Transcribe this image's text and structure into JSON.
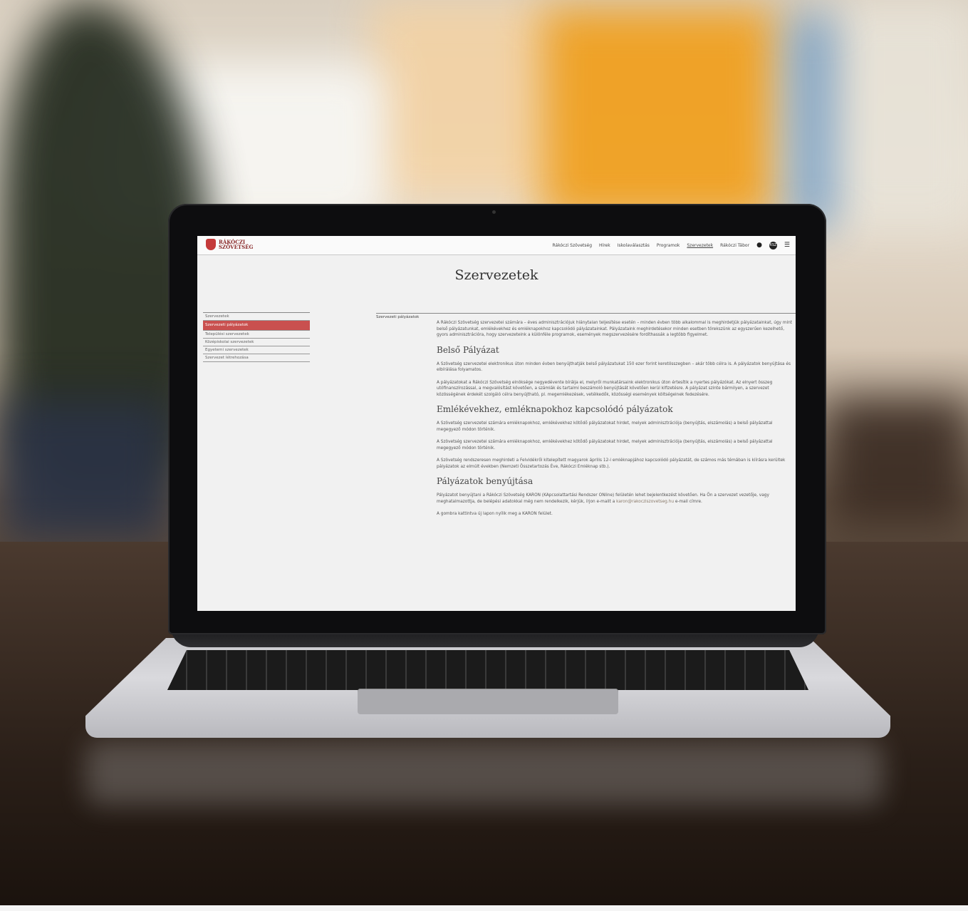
{
  "nav": {
    "logo_line1": "RÁKÓCZI",
    "logo_line2": "SZÖVETSÉG",
    "links": [
      "Rákóczi Szövetség",
      "Hírek",
      "Iskolaválasztás",
      "Programok",
      "Szervezetek",
      "Rákóczi Tábor"
    ],
    "active_link": "Szervezetek",
    "icons": [
      "search-icon",
      "user-icon",
      "menu-icon"
    ],
    "badge": "RSZ"
  },
  "page": {
    "title": "Szervezetek"
  },
  "sidebar": {
    "items": [
      "Szervezetek",
      "Szervezeti pályázatok",
      "Települési szervezetek",
      "Középiskolai szervezetek",
      "Egyetemi szervezetek",
      "Szervezet létrehozása"
    ],
    "active_index": 1
  },
  "content": {
    "section_label": "Szervezeti pályázatok",
    "intro": "A Rákóczi Szövetség szervezetei számára – éves adminisztrációjuk hiánytalan teljesítése esetén – minden évben több alkalommal is meghirdetjük pályázatainkat, úgy mint belső pályázatunkat, emlékévekhez és emléknapokhoz kapcsolódó pályázatainkat. Pályázataink meghirdetésekor minden esetben törekszünk az egyszerűen kezelhető, gyors adminisztrációra, hogy szervezeteink a különféle programok, események megszervezésére fordíthassák a legtöbb figyelmet.",
    "h_belso": "Belső Pályázat",
    "belso_p1": "A Szövetség szervezetei elektronikus úton minden évben benyújthatják belső pályázatukat 150 ezer forint keretösszegben – akár több célra is. A pályázatok benyújtása és elbírálása folyamatos.",
    "belso_p2": "A pályázatokat a Rákóczi Szövetség elnöksége negyedévente bírálja el, melyről munkatársaink elektronikus úton értesítik a nyertes pályázókat. Az elnyert összeg utófinanszírozással, a megvalósítást követően, a számlák és tartalmi beszámoló benyújtását követően kerül kifizetésre. A pályázat szinte bármilyen, a szervezet közösségének érdekét szolgáló célra benyújtható, pl. megemlékezések, vetélkedők, közösségi események költségeinek fedezésére.",
    "h_emlek": "Emlékévekhez, emléknapokhoz kapcsolódó pályázatok",
    "emlek_p1": "A Szövetség szervezetei számára emléknapokhoz, emlékévekhez kötődő pályázatokat hirdet, melyek adminisztrációja (benyújtás, elszámolás) a belső pályázattal megegyező módon történik.",
    "emlek_p2": "A Szövetség szervezetei számára emléknapokhoz, emlékévekhez kötődő pályázatokat hirdet, melyek adminisztrációja (benyújtás, elszámolás) a belső pályázattal megegyező módon történik.",
    "emlek_p3": "A Szövetség rendszeresen meghirdeti a Felvidékről kitelepített magyarok április 12-i emléknapjához kapcsolódó pályázatát, de számos más témában is kiírásra kerültek pályázatok az elmúlt években (Nemzeti Összetartozás Éve, Rákóczi Emléknap stb.).",
    "h_benyujt": "Pályázatok benyújtása",
    "benyujt_p1_a": "Pályázatot benyújtani a Rákóczi Szövetség KARON (KApcsolattartási Rendszer ONline) felületén lehet bejelentkezést követően. Ha Ön a szervezet vezetője, vagy meghatalmazottja, de belépési adatokkal még nem rendelkezik, kérjük, írjon e-mailt a ",
    "benyujt_email": "karon@rakocziszovetseg.hu",
    "benyujt_p1_b": " e-mail címre.",
    "benyujt_p2": "A gombra kattintva új lapon nyílik meg a KARON felület."
  }
}
